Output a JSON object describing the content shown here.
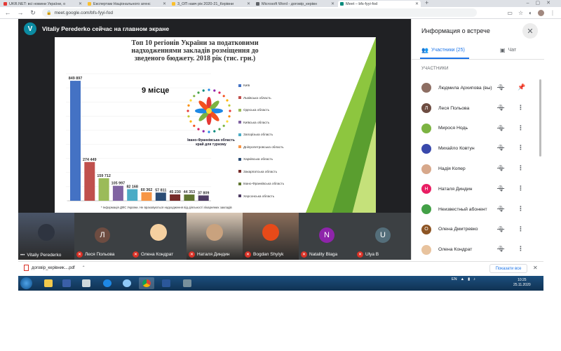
{
  "browser": {
    "tabs": [
      {
        "title": "UKR.NET: всі новини України, о",
        "fav_color": "#e53935"
      },
      {
        "title": "Експертам Національного агенс",
        "fav_color": "#fbc02d"
      },
      {
        "title": "3_ОП навч рік 2020-21_Керівни",
        "fav_color": "#fbc02d"
      },
      {
        "title": "Microsoft Word - договір_керівн",
        "fav_color": "#5f6368"
      },
      {
        "title": "Meet – bfs-fyyi-fod",
        "fav_color": "#00897b"
      }
    ],
    "url": "meet.google.com/bfs-fyyi-fod"
  },
  "stage": {
    "presenter_initial": "V",
    "presenter_text": "Vitaliy Perederko сейчас на главном экране"
  },
  "slide": {
    "title_line1": "Топ 10 регіонів України за податковими",
    "title_line2": "надходженнями закладів розміщення до",
    "title_line3": "зведеного бюджету. 2018 рік (тис. грн.)",
    "place": "9 місце",
    "logo_caption_line1": "Івано-Франківська область",
    "logo_caption_line2": "край для туризму",
    "footnote": "* Інформація ДФС України. Не враховуються надходження від діяльності лікарняних закладів"
  },
  "chart_data": {
    "type": "bar",
    "title": "Топ 10 регіонів України за податковими надходженнями закладів розміщення до зведеного бюджету. 2018 рік (тис. грн.)",
    "categories": [
      "Київ",
      "Львівська область",
      "Одеська область",
      "Київська область",
      "Запорізька область",
      "Дніпропетровська область",
      "Харківська область",
      "Закарпатська область",
      "Івано-Франківська область",
      "Херсонська область"
    ],
    "values": [
      849897,
      274449,
      159712,
      105997,
      82168,
      60362,
      57811,
      45230,
      44353,
      37809
    ],
    "value_labels": [
      "849 897",
      "274 449",
      "159 712",
      "105 997",
      "82 168",
      "60 362",
      "57 811",
      "45 230",
      "44 353",
      "37 809"
    ],
    "colors": [
      "#4472c4",
      "#c0504d",
      "#9bbb59",
      "#8064a2",
      "#4bacc6",
      "#f79646",
      "#2c4d75",
      "#772c2a",
      "#5f7530",
      "#4d3b62"
    ],
    "ylim": [
      0,
      900000
    ],
    "legend": "right"
  },
  "tiles": [
    {
      "name": "Vitaliy Perederko",
      "initial": "",
      "av_color": "#2e3440",
      "muted": false,
      "photo": "#4a5568"
    },
    {
      "name": "Леся Польова",
      "initial": "Л",
      "av_color": "#6d4c41",
      "muted": true,
      "photo": ""
    },
    {
      "name": "Олена Кондрат",
      "initial": "",
      "av_color": "#f5d0a0",
      "muted": true,
      "photo": ""
    },
    {
      "name": "Наталя Диндин",
      "initial": "",
      "av_color": "#c9a27e",
      "muted": true,
      "photo": "#d8c7b5"
    },
    {
      "name": "Bogdan Shylyk",
      "initial": "",
      "av_color": "#e64a19",
      "muted": true,
      "photo": "#8a6d5a"
    },
    {
      "name": "Natality Blaga",
      "initial": "N",
      "av_color": "#8e24aa",
      "muted": true,
      "photo": ""
    },
    {
      "name": "Ulya B",
      "initial": "U",
      "av_color": "#546e7a",
      "muted": true,
      "photo": ""
    }
  ],
  "panel": {
    "title": "Информация о встрече",
    "tab_people": "Участники (25)",
    "tab_chat": "Чат",
    "list_header": "УЧАСТНИКИ",
    "participants": [
      {
        "name": "Людмила Архипова (вы)",
        "initial": "",
        "color": "#8d6e63",
        "pin": true
      },
      {
        "name": "Леся Польова",
        "initial": "Л",
        "color": "#6d4c41",
        "pin": false
      },
      {
        "name": "Мирося Нодь",
        "initial": "",
        "color": "#7cb342",
        "pin": false
      },
      {
        "name": "Михайло Ковтун",
        "initial": "",
        "color": "#3949ab",
        "pin": false
      },
      {
        "name": "Надія Копер",
        "initial": "",
        "color": "#d7a88b",
        "pin": false
      },
      {
        "name": "Наталя Диндин",
        "initial": "Н",
        "color": "#e91e63",
        "pin": false
      },
      {
        "name": "Неизвестный абонент",
        "initial": "",
        "color": "#43a047",
        "pin": false
      },
      {
        "name": "Олена Дмитревко",
        "initial": "О",
        "color": "#8d5524",
        "pin": false
      },
      {
        "name": "Олена Кондрат",
        "initial": "",
        "color": "#e8c39e",
        "pin": false
      }
    ]
  },
  "download": {
    "file": "договір_керівник....pdf",
    "show_all": "Показати все"
  },
  "taskbar": {
    "lang": "EN",
    "time": "10:25",
    "date": "25.11.2020"
  }
}
